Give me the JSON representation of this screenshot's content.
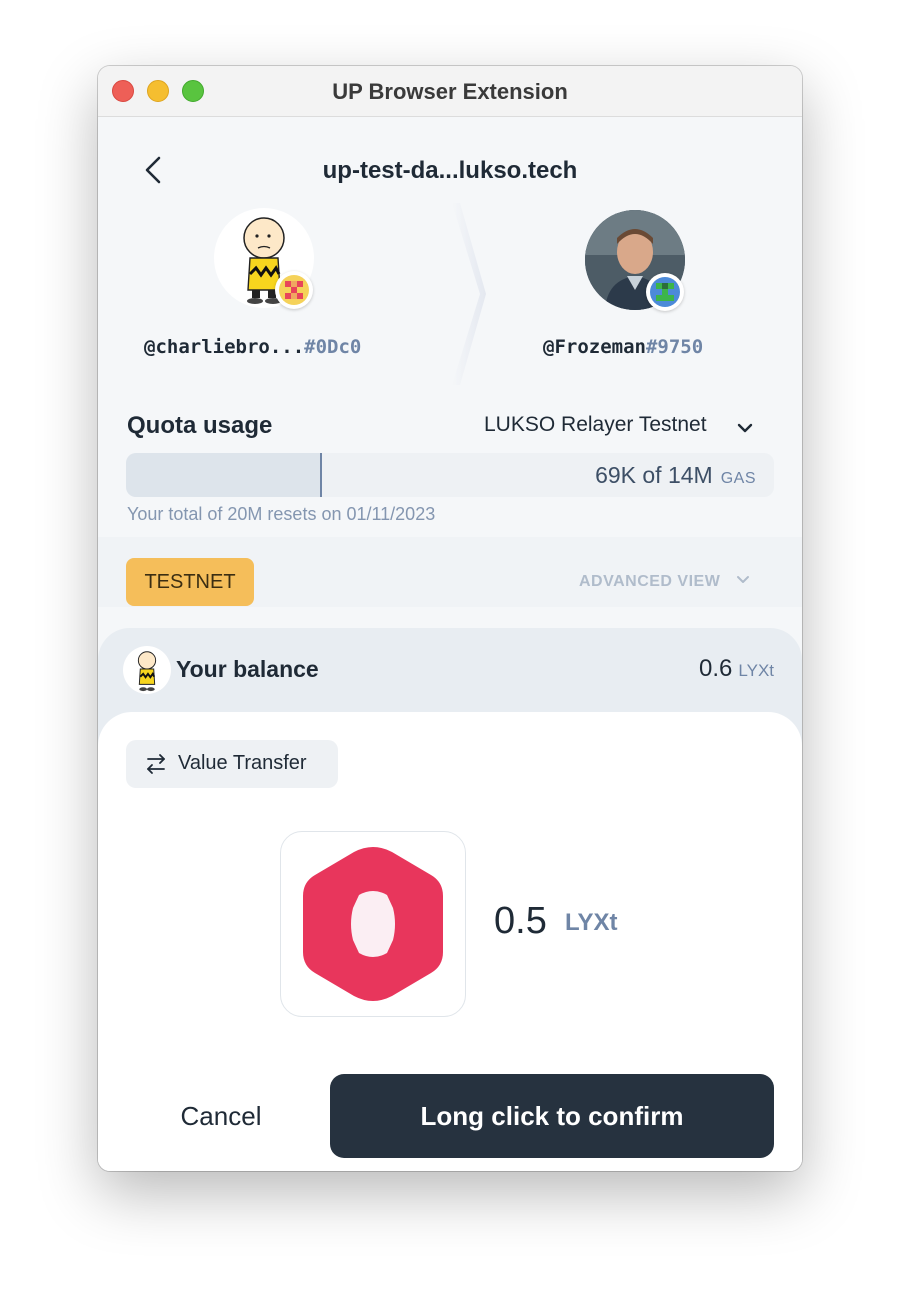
{
  "window": {
    "title": "UP Browser Extension"
  },
  "header": {
    "site": "up-test-da...lukso.tech"
  },
  "sender": {
    "handle": "@charliebro...",
    "tag": "#0Dc0"
  },
  "recipient": {
    "handle": "@Frozeman",
    "tag": "#9750"
  },
  "quota": {
    "title": "Quota usage",
    "relayer": "LUKSO Relayer Testnet",
    "used_label": "69K of 14M",
    "unit": "GAS",
    "fill_fraction": 0.3,
    "note": "Your total of 20M resets on 01/11/2023"
  },
  "network": {
    "badge": "TESTNET",
    "advanced": "ADVANCED VIEW"
  },
  "balance": {
    "label": "Your balance",
    "value": "0.6",
    "unit": "LYXt"
  },
  "transfer": {
    "type_label": "Value Transfer",
    "amount": "0.5",
    "unit": "LYXt"
  },
  "actions": {
    "cancel": "Cancel",
    "confirm": "Long click to confirm"
  },
  "colors": {
    "accent": "#26323f",
    "testnet": "#f5be5a",
    "token": "#e8365c"
  }
}
